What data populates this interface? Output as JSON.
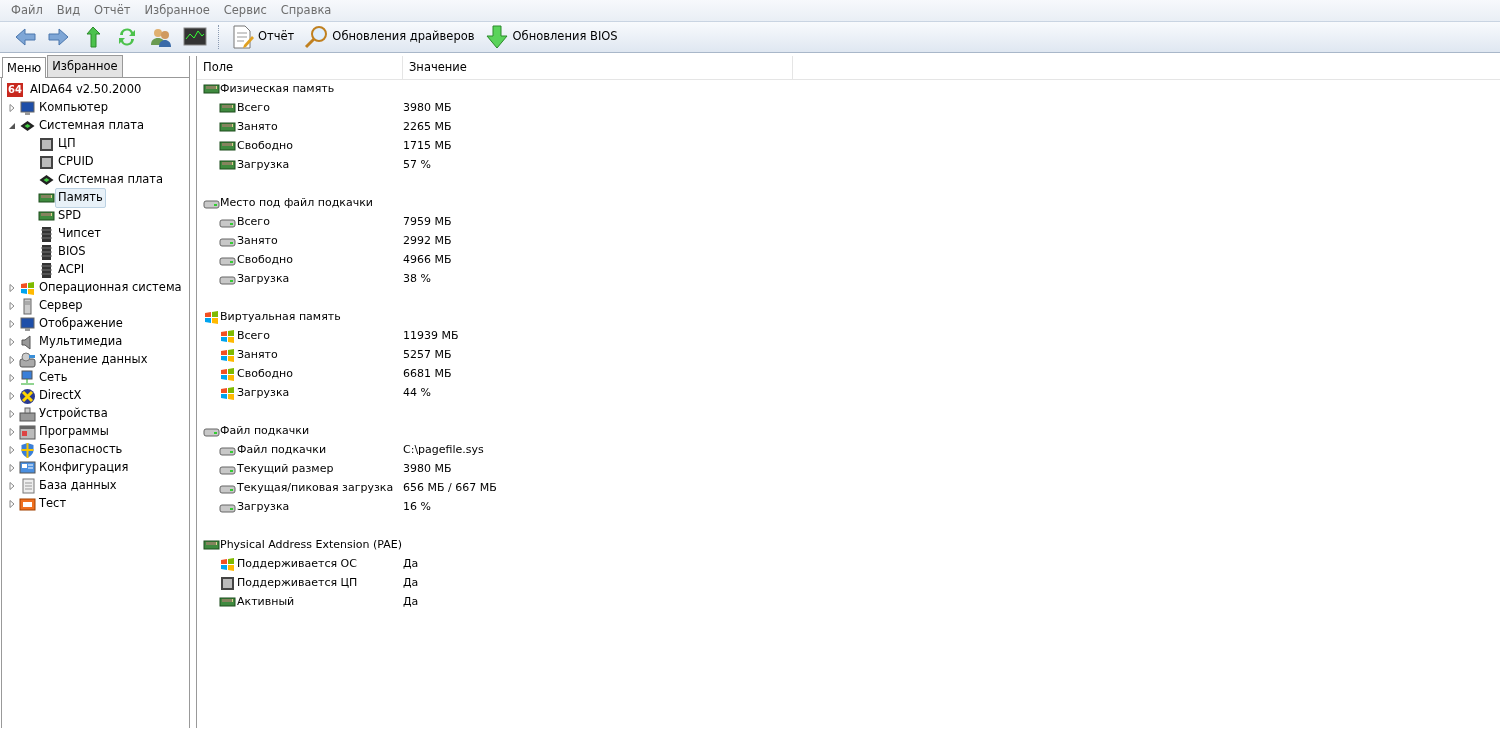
{
  "menu_bar": [
    "Файл",
    "Вид",
    "Отчёт",
    "Избранное",
    "Сервис",
    "Справка"
  ],
  "toolbar": {
    "icon_buttons": [
      {
        "kind": "back"
      },
      {
        "kind": "forward"
      },
      {
        "kind": "up"
      },
      {
        "kind": "refresh"
      },
      {
        "kind": "users"
      },
      {
        "kind": "monitor"
      }
    ],
    "text_buttons": [
      {
        "kind": "report",
        "label": "Отчёт"
      },
      {
        "kind": "search",
        "label": "Обновления драйверов"
      },
      {
        "kind": "download",
        "label": "Обновления BIOS"
      }
    ]
  },
  "sidebar": {
    "tabs": [
      {
        "label": "Меню",
        "selected": true
      },
      {
        "label": "Избранное",
        "selected": false
      }
    ],
    "tree": {
      "label": "AIDA64 v2.50.2000",
      "logo_text": "64",
      "children": [
        {
          "label": "Компьютер",
          "kind": "computer",
          "expanded": false,
          "selected": false
        },
        {
          "label": "Системная плата",
          "kind": "board",
          "expanded": true,
          "selected": false,
          "children": [
            {
              "label": "ЦП",
              "kind": "chip",
              "selected": false
            },
            {
              "label": "CPUID",
              "kind": "chip",
              "selected": false
            },
            {
              "label": "Системная плата",
              "kind": "board",
              "selected": false
            },
            {
              "label": "Память",
              "kind": "ram",
              "selected": true
            },
            {
              "label": "SPD",
              "kind": "ram",
              "selected": false
            },
            {
              "label": "Чипсет",
              "kind": "chipset",
              "selected": false
            },
            {
              "label": "BIOS",
              "kind": "chipset",
              "selected": false
            },
            {
              "label": "ACPI",
              "kind": "chipset",
              "selected": false
            }
          ]
        },
        {
          "label": "Операционная система",
          "kind": "windows",
          "expanded": false,
          "selected": false
        },
        {
          "label": "Сервер",
          "kind": "server",
          "expanded": false,
          "selected": false
        },
        {
          "label": "Отображение",
          "kind": "computer",
          "expanded": false,
          "selected": false
        },
        {
          "label": "Мультимедиа",
          "kind": "speaker",
          "expanded": false,
          "selected": false
        },
        {
          "label": "Хранение данных",
          "kind": "storage",
          "expanded": false,
          "selected": false
        },
        {
          "label": "Сеть",
          "kind": "network",
          "expanded": false,
          "selected": false
        },
        {
          "label": "DirectX",
          "kind": "directx",
          "expanded": false,
          "selected": false
        },
        {
          "label": "Устройства",
          "kind": "devices",
          "expanded": false,
          "selected": false
        },
        {
          "label": "Программы",
          "kind": "programs",
          "expanded": false,
          "selected": false
        },
        {
          "label": "Безопасность",
          "kind": "shield",
          "expanded": false,
          "selected": false
        },
        {
          "label": "Конфигурация",
          "kind": "config",
          "expanded": false,
          "selected": false
        },
        {
          "label": "База данных",
          "kind": "database",
          "expanded": false,
          "selected": false
        },
        {
          "label": "Тест",
          "kind": "test",
          "expanded": false,
          "selected": false
        }
      ]
    }
  },
  "table": {
    "columns": [
      "Поле",
      "Значение"
    ],
    "sections": [
      {
        "title": "Физическая память",
        "kind": "ram",
        "rows": [
          {
            "field": "Всего",
            "value": "3980 МБ",
            "kind": "ram"
          },
          {
            "field": "Занято",
            "value": "2265 МБ",
            "kind": "ram"
          },
          {
            "field": "Свободно",
            "value": "1715 МБ",
            "kind": "ram"
          },
          {
            "field": "Загрузка",
            "value": "57 %",
            "kind": "ram"
          }
        ]
      },
      {
        "title": "Место под файл подкачки",
        "kind": "disk",
        "rows": [
          {
            "field": "Всего",
            "value": "7959 МБ",
            "kind": "disk"
          },
          {
            "field": "Занято",
            "value": "2992 МБ",
            "kind": "disk"
          },
          {
            "field": "Свободно",
            "value": "4966 МБ",
            "kind": "disk"
          },
          {
            "field": "Загрузка",
            "value": "38 %",
            "kind": "disk"
          }
        ]
      },
      {
        "title": "Виртуальная память",
        "kind": "windows",
        "rows": [
          {
            "field": "Всего",
            "value": "11939 МБ",
            "kind": "windows"
          },
          {
            "field": "Занято",
            "value": "5257 МБ",
            "kind": "windows"
          },
          {
            "field": "Свободно",
            "value": "6681 МБ",
            "kind": "windows"
          },
          {
            "field": "Загрузка",
            "value": "44 %",
            "kind": "windows"
          }
        ]
      },
      {
        "title": "Файл подкачки",
        "kind": "disk",
        "rows": [
          {
            "field": "Файл подкачки",
            "value": "C:\\pagefile.sys",
            "kind": "disk"
          },
          {
            "field": "Текущий размер",
            "value": "3980 МБ",
            "kind": "disk"
          },
          {
            "field": "Текущая/пиковая загрузка",
            "value": "656 МБ / 667 МБ",
            "kind": "disk"
          },
          {
            "field": "Загрузка",
            "value": "16 %",
            "kind": "disk"
          }
        ]
      },
      {
        "title": "Physical Address Extension (PAE)",
        "kind": "ram",
        "rows": [
          {
            "field": "Поддерживается ОС",
            "value": "Да",
            "kind": "windows"
          },
          {
            "field": "Поддерживается ЦП",
            "value": "Да",
            "kind": "chip"
          },
          {
            "field": "Активный",
            "value": "Да",
            "kind": "ram"
          }
        ]
      }
    ]
  }
}
